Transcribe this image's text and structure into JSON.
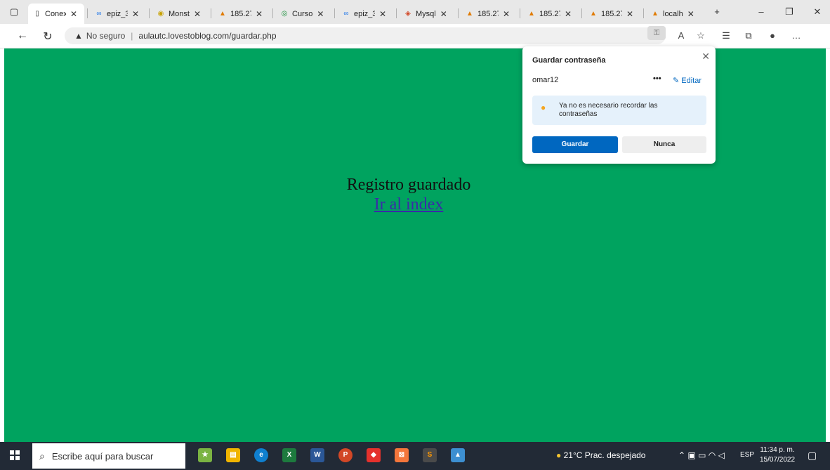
{
  "browser": {
    "tabs": [
      {
        "title": "Conex",
        "icon": "page-icon",
        "active": true
      },
      {
        "title": "epiz_3",
        "icon": "infinity-icon"
      },
      {
        "title": "Monst",
        "icon": "monster-icon"
      },
      {
        "title": "185.27",
        "icon": "phpmyadmin-icon"
      },
      {
        "title": "Curso",
        "icon": "course-icon"
      },
      {
        "title": "epiz_3",
        "icon": "infinity-icon"
      },
      {
        "title": "Mysql",
        "icon": "mysql-icon"
      },
      {
        "title": "185.27",
        "icon": "phpmyadmin-icon"
      },
      {
        "title": "185.27",
        "icon": "phpmyadmin-icon"
      },
      {
        "title": "185.27",
        "icon": "phpmyadmin-icon"
      },
      {
        "title": "localh",
        "icon": "phpmyadmin-icon"
      }
    ],
    "security_label": "No seguro",
    "url": "aulautc.lovestoblog.com/guardar.php"
  },
  "page": {
    "background": "#00a35f",
    "message": "Registro guardado",
    "link_text": "Ir al index"
  },
  "password_popup": {
    "title": "Guardar contraseña",
    "username": "omar12",
    "more_label": "•••",
    "edit_label": "Editar",
    "tip": "Ya no es necesario recordar las contraseñas",
    "save_label": "Guardar",
    "never_label": "Nunca"
  },
  "taskbar": {
    "search_placeholder": "Escribe aquí para buscar",
    "weather": "21°C  Prac. despejado",
    "language": "ESP",
    "time": "11:34 p. m.",
    "date": "15/07/2022"
  }
}
